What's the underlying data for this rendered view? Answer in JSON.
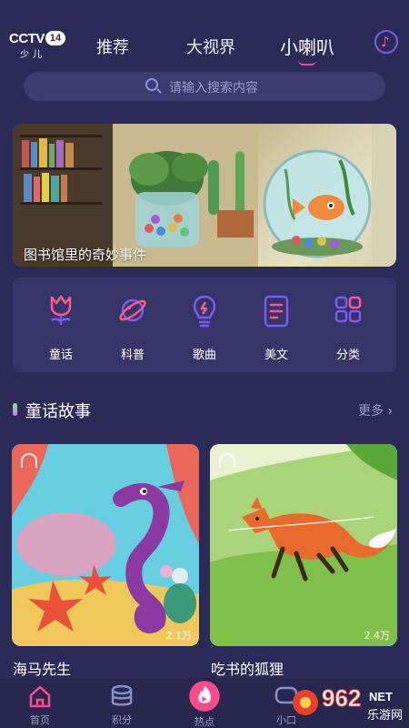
{
  "header": {
    "logo_text": "CCTV",
    "logo_channel": "14",
    "logo_sub": "少儿",
    "tabs": [
      "推荐",
      "大视界",
      "小喇叭"
    ],
    "active_tab": "小喇叭",
    "music_icon": "music-note-icon"
  },
  "search": {
    "placeholder": "请输入搜索内容",
    "icon": "search-icon"
  },
  "banner": {
    "caption": "图书馆里的奇妙事件"
  },
  "categories": [
    {
      "label": "童话",
      "icon": "tulip-icon"
    },
    {
      "label": "科普",
      "icon": "planet-icon"
    },
    {
      "label": "歌曲",
      "icon": "lightbulb-icon"
    },
    {
      "label": "美文",
      "icon": "document-icon"
    },
    {
      "label": "分类",
      "icon": "grid-icon"
    }
  ],
  "section": {
    "title": "童话故事",
    "more_label": "更多",
    "more_icon": "chevron-right-icon"
  },
  "cards": [
    {
      "title": "海马先生",
      "count": "2.1万",
      "icon": "headphones-icon"
    },
    {
      "title": "吃书的狐狸",
      "count": "2.4万",
      "icon": "headphones-icon"
    }
  ],
  "bottom_nav": [
    {
      "label": "首页",
      "icon": "home-icon"
    },
    {
      "label": "积分",
      "icon": "coins-icon"
    },
    {
      "label": "热点",
      "icon": "flame-play-icon"
    },
    {
      "label": "小口",
      "icon": "chat-icon"
    }
  ],
  "watermark": {
    "text": "962",
    "text2": "NET",
    "text3": "乐游网"
  },
  "colors": {
    "background": "#2b2b57",
    "accent": "#ff4b8b",
    "panel": "#35356a",
    "icon": "#7a5cf0"
  }
}
